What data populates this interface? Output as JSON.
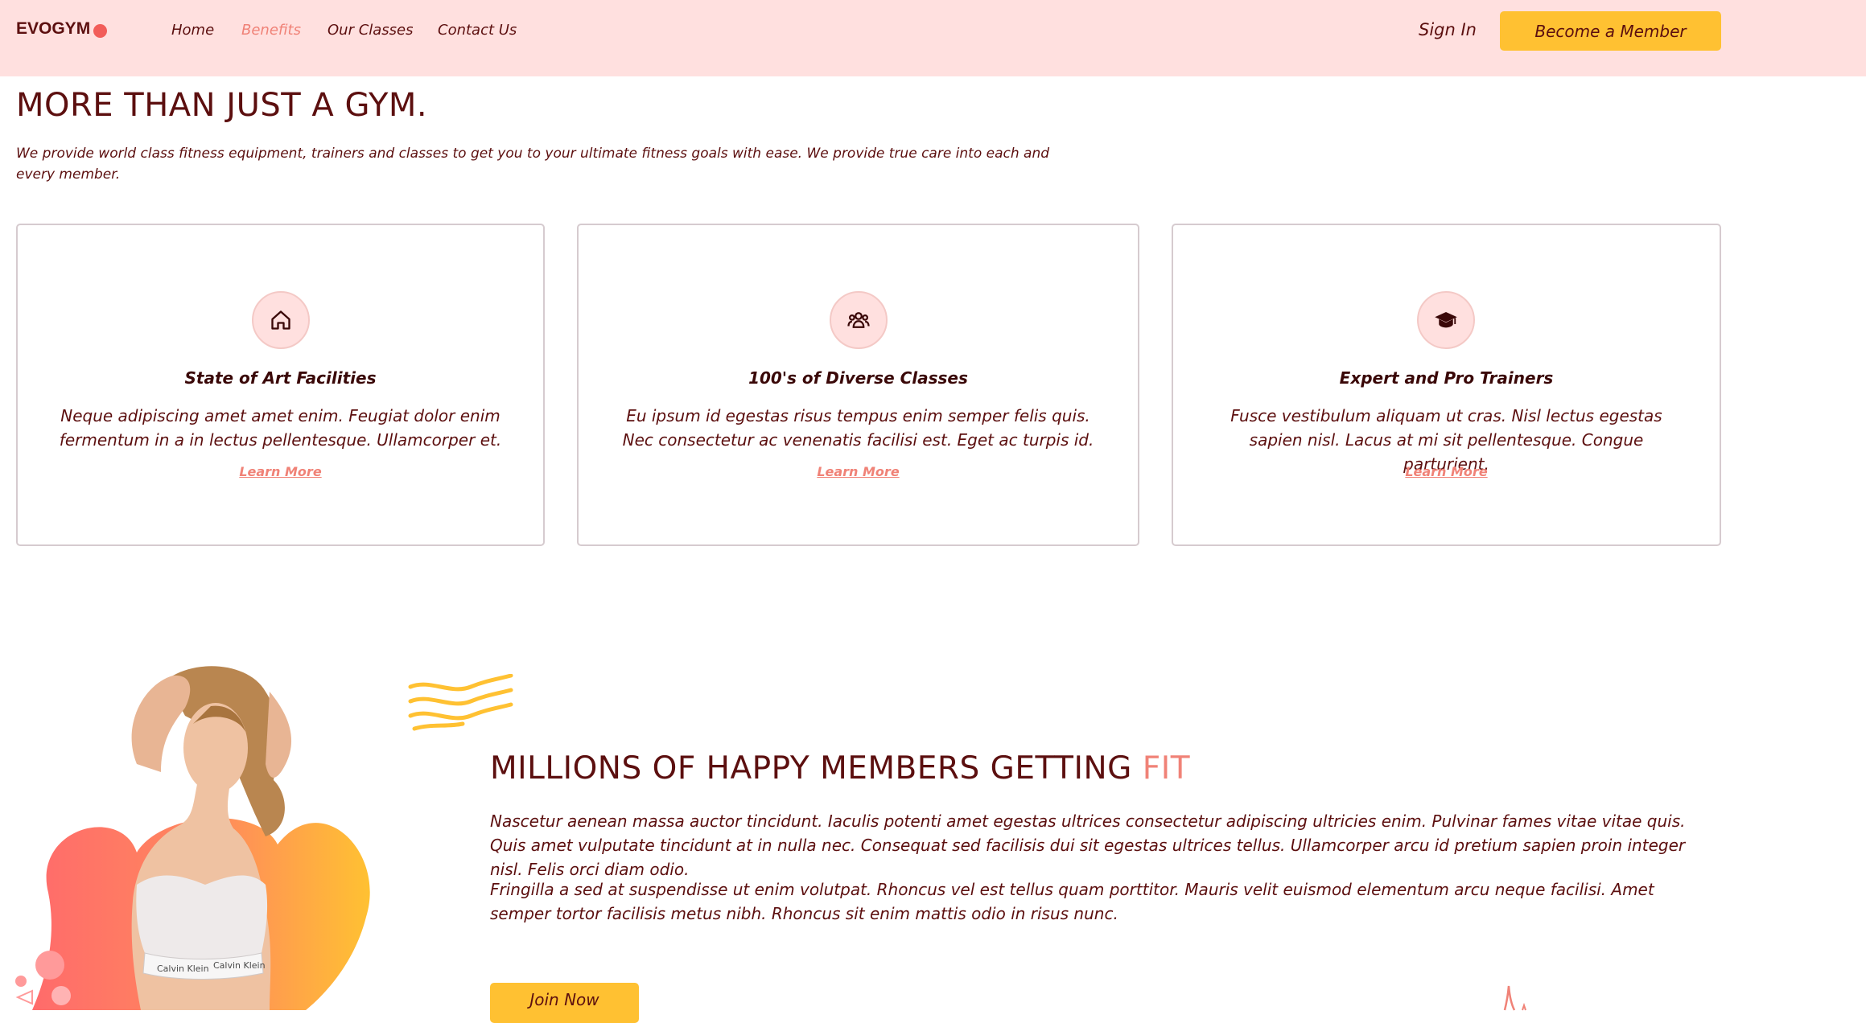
{
  "nav": {
    "logo": "EVOGYM",
    "links": [
      "Home",
      "Benefits",
      "Our Classes",
      "Contact Us"
    ],
    "active_link": "Benefits",
    "sign_in": "Sign In",
    "cta": "Become a Member"
  },
  "benefits": {
    "title": "MORE THAN JUST A GYM.",
    "intro": "We provide world class fitness equipment, trainers and classes to get you to your ultimate fitness goals with ease. We provide true care into each and every member.",
    "cards": [
      {
        "icon": "home-icon",
        "title": "State of Art Facilities",
        "text": "Neque adipiscing amet amet enim. Feugiat dolor enim fermentum in a in lectus pellentesque. Ullamcorper et.",
        "link": "Learn More"
      },
      {
        "icon": "users-group-icon",
        "title": "100's of Diverse Classes",
        "text": "Eu ipsum id egestas risus tempus enim semper felis quis. Nec consectetur ac venenatis facilisi est. Eget ac turpis id.",
        "link": "Learn More"
      },
      {
        "icon": "graduation-cap-icon",
        "title": "Expert and Pro Trainers",
        "text": "Fusce vestibulum aliquam ut cras. Nisl lectus egestas sapien nisl. Lacus at mi sit pellentesque. Congue parturient.",
        "link": "Learn More"
      }
    ]
  },
  "members": {
    "heading": "MILLIONS OF HAPPY MEMBERS GETTING",
    "heading_accent": "FIT",
    "paragraph_1": "Nascetur aenean massa auctor tincidunt. Iaculis potenti amet egestas ultrices consectetur adipiscing ultricies enim. Pulvinar fames vitae vitae quis. Quis amet vulputate tincidunt at in nulla nec. Consequat sed facilisis dui sit egestas ultrices tellus. Ullamcorper arcu id pretium sapien proin integer nisl. Felis orci diam odio.",
    "paragraph_2": "Fringilla a sed at suspendisse ut enim volutpat. Rhoncus vel est tellus quam porttitor. Mauris velit euismod elementum arcu neque facilisi. Amet semper tortor facilisis metus nibh. Rhoncus sit enim mattis odio in risus nunc.",
    "cta": "Join Now",
    "image_subject": "woman-fitness-photo",
    "waist_band": "Calvin Klein"
  },
  "colors": {
    "nav_bg": "#ffe0df",
    "primary_text": "#5c0f0f",
    "accent": "#f08277",
    "button": "#ffc132",
    "logo_dot": "#f25d59"
  }
}
